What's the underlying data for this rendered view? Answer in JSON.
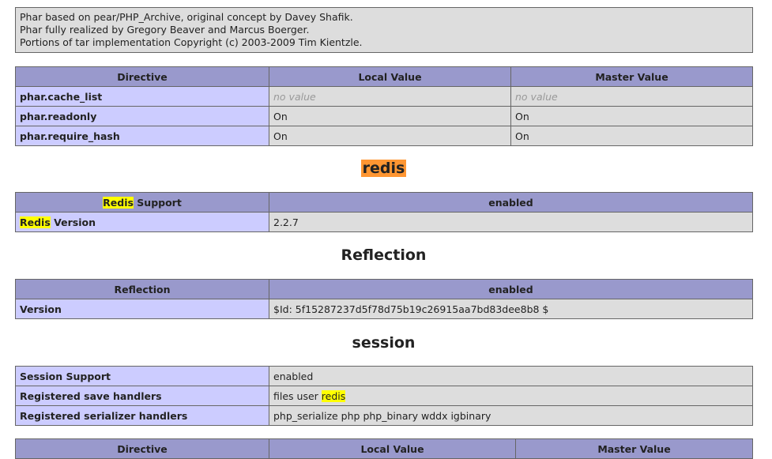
{
  "credits": {
    "line1": "Phar based on pear/PHP_Archive, original concept by Davey Shafik.",
    "line2": "Phar fully realized by Gregory Beaver and Marcus Boerger.",
    "line3": "Portions of tar implementation Copyright (c) 2003-2009 Tim Kientzle."
  },
  "phar_directives": {
    "headers": [
      "Directive",
      "Local Value",
      "Master Value"
    ],
    "rows": [
      {
        "name": "phar.cache_list",
        "local": "no value",
        "master": "no value"
      },
      {
        "name": "phar.readonly",
        "local": "On",
        "master": "On"
      },
      {
        "name": "phar.require_hash",
        "local": "On",
        "master": "On"
      }
    ]
  },
  "redis": {
    "title": "redis",
    "support_hl": "Redis",
    "support_rest": " Support",
    "support_value": "enabled",
    "version_hl": "Redis",
    "version_rest": " Version",
    "version_value": "2.2.7"
  },
  "reflection": {
    "title": "Reflection",
    "header_label": "Reflection",
    "header_value": "enabled",
    "version_label": "Version",
    "version_value": "$Id: 5f15287237d5f78d75b19c26915aa7bd83dee8b8 $"
  },
  "session": {
    "title": "session",
    "support_label": "Session Support",
    "support_value": "enabled",
    "save_label": "Registered save handlers",
    "save_value_plain": "files user ",
    "save_value_hl": "redis",
    "serializer_label": "Registered serializer handlers",
    "serializer_value": "php_serialize php php_binary wddx igbinary"
  },
  "session_directives": {
    "headers": [
      "Directive",
      "Local Value",
      "Master Value"
    ]
  },
  "colors": {
    "header_bg": "#9999cc",
    "label_bg": "#ccccff",
    "value_bg": "#dddddd",
    "search_highlight": "#ffff00",
    "active_highlight": "#ff9632"
  }
}
